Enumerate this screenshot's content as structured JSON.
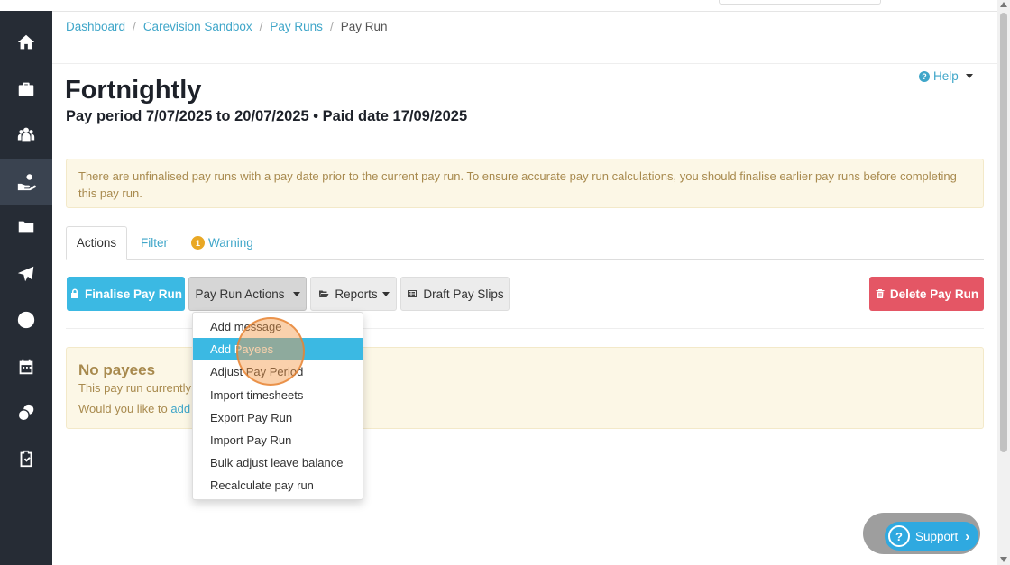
{
  "breadcrumb": {
    "items": [
      "Dashboard",
      "Carevision Sandbox",
      "Pay Runs"
    ],
    "current": "Pay Run",
    "separator": "/"
  },
  "help": {
    "label": "Help",
    "icon": "question-circle-icon"
  },
  "page": {
    "title": "Fortnightly",
    "subtitle": "Pay period 7/07/2025 to 20/07/2025 • Paid date 17/09/2025"
  },
  "alert": {
    "text": "There are unfinalised pay runs with a pay date prior to the current pay run. To ensure accurate pay run calculations, you should finalise earlier pay runs before completing this pay run."
  },
  "tabs": {
    "actions": "Actions",
    "filter": "Filter",
    "warning": "Warning",
    "warning_count": "1"
  },
  "toolbar": {
    "finalise": "Finalise Pay Run",
    "pay_run_actions": "Pay Run Actions",
    "reports": "Reports",
    "draft_pay_slips": "Draft Pay Slips",
    "delete": "Delete Pay Run"
  },
  "no_payees": {
    "title": "No payees",
    "line1": "This pay run currently",
    "line2_prefix": "Would you like to",
    "line2_link": "add"
  },
  "menu": {
    "items": [
      "Add message",
      "Add Payees",
      "Adjust Pay Period",
      "Import timesheets",
      "Export Pay Run",
      "Import Pay Run",
      "Bulk adjust leave balance",
      "Recalculate pay run"
    ],
    "highlighted": "Add Payees"
  },
  "support": {
    "label": "Support",
    "icon": "question-icon"
  },
  "sidebar": {
    "icons": [
      "home-icon",
      "briefcase-icon",
      "people-icon",
      "hand-money-icon",
      "folder-icon",
      "plane-icon",
      "clock-icon",
      "calendar-icon",
      "coins-icon",
      "clipboard-check-icon"
    ],
    "active": "hand-money-icon"
  },
  "colors": {
    "sidebar": "#262c35",
    "link": "#3fa6c9",
    "primary": "#3bb9e3",
    "danger": "#e45665",
    "alert_bg": "#fcf7e6",
    "alert_text": "#a88a4e"
  }
}
